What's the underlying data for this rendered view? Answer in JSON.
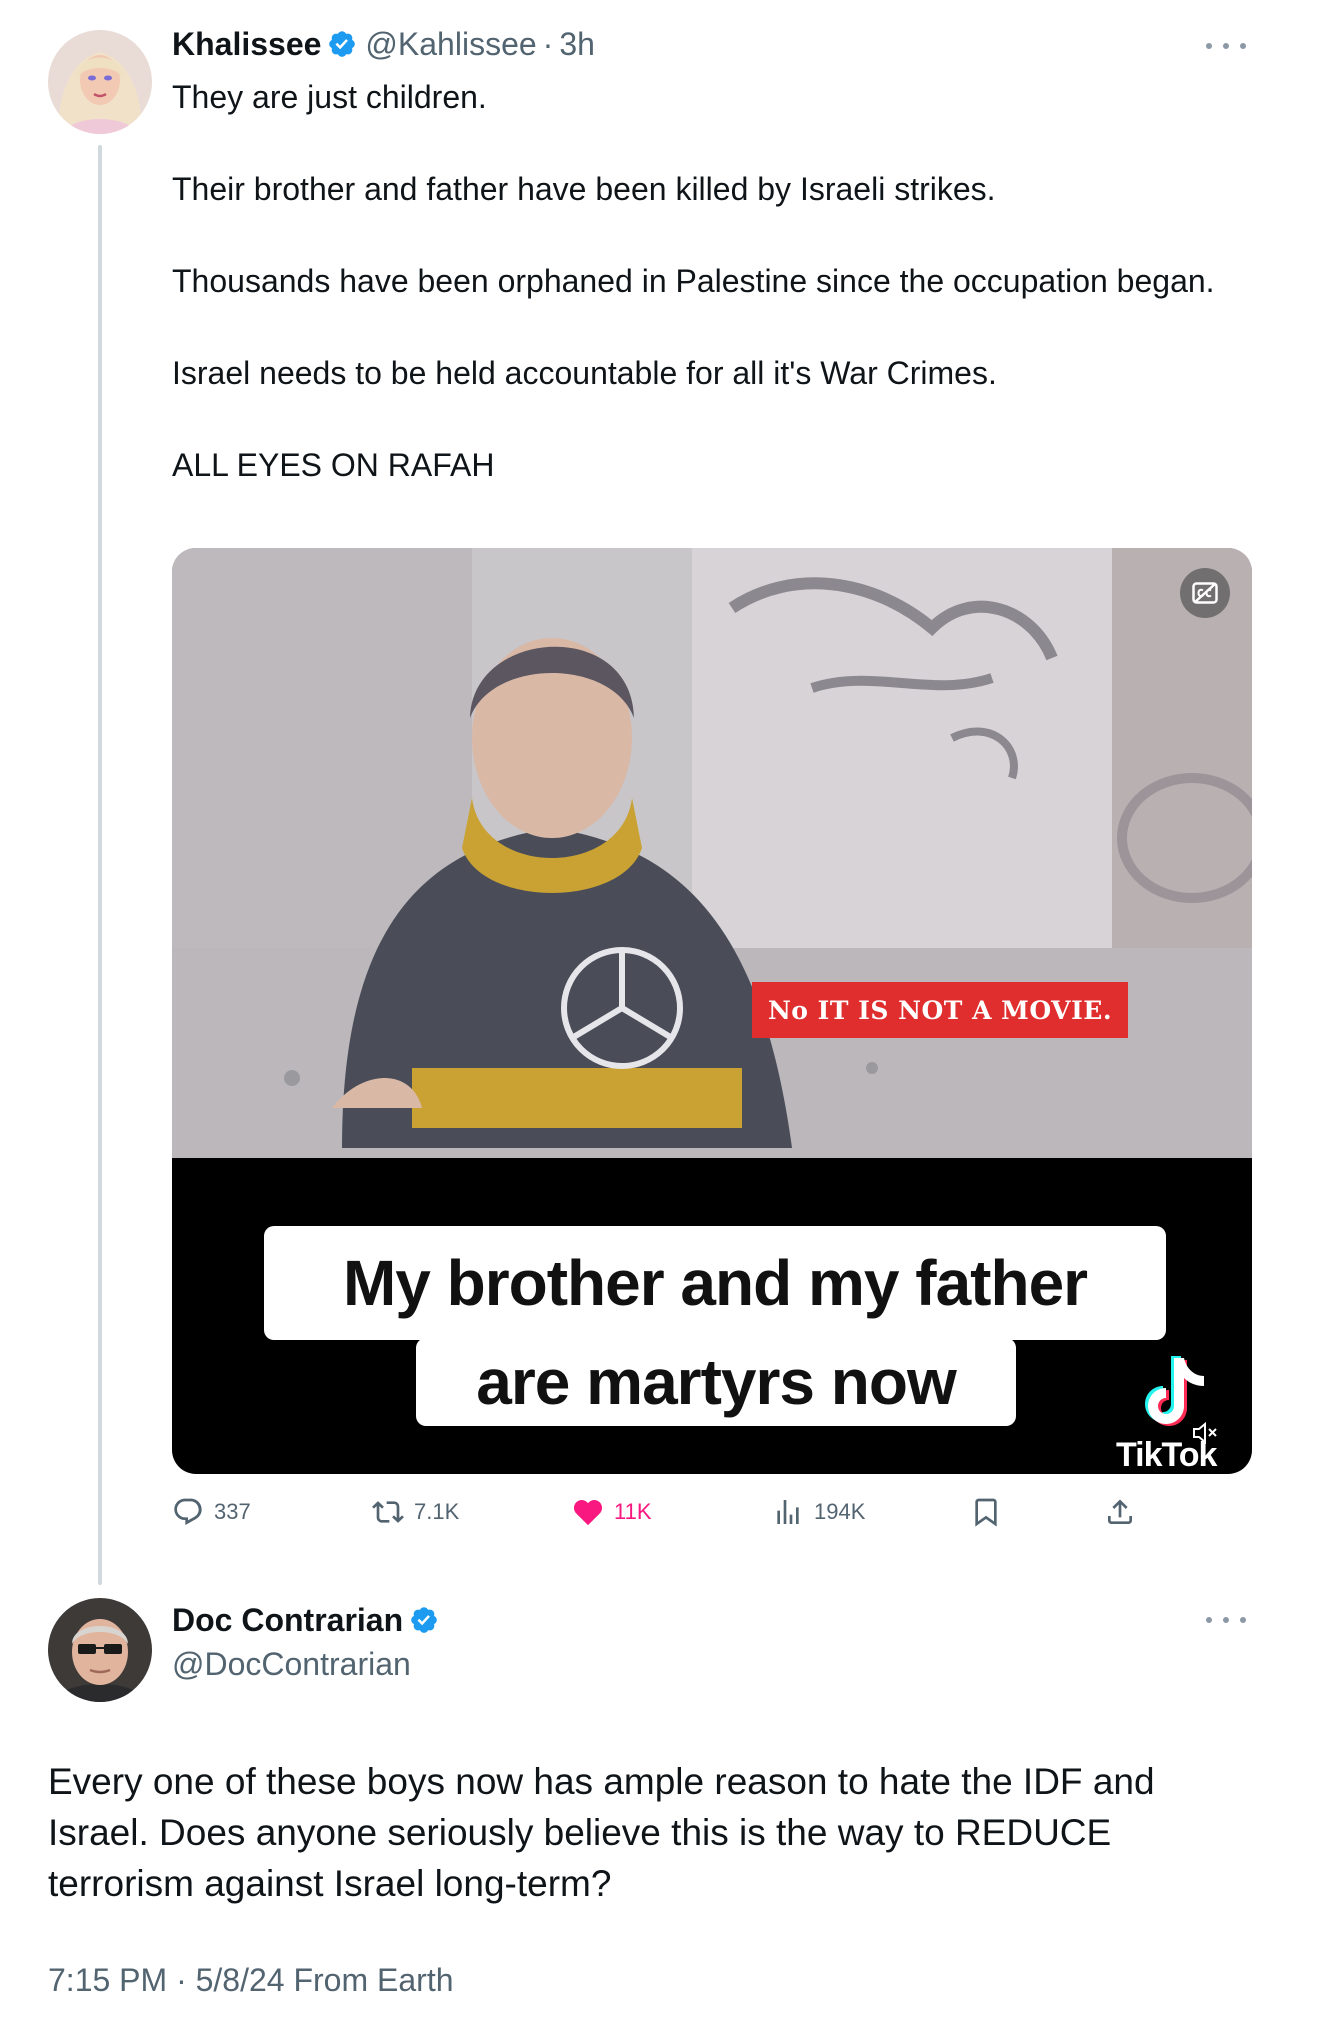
{
  "tweet1": {
    "author_name": "Khalissee",
    "handle": "@Kahlissee",
    "separator": "·",
    "time_ago": "3h",
    "paragraphs": [
      "They are just children.",
      "Their brother and father have been killed by Israeli strikes.",
      "Thousands have been orphaned in Palestine since the occupation began.",
      "Israel needs to be held accountable for all it's War Crimes.",
      "ALL EYES ON RAFAH"
    ],
    "media": {
      "banner_text": "No IT IS NOT A MOVIE.",
      "caption_line1": "My brother and my father",
      "caption_line2": "are martyrs now",
      "watermark": "TikTok"
    },
    "actions": {
      "replies": "337",
      "reposts": "7.1K",
      "likes": "11K",
      "views": "194K"
    }
  },
  "tweet2": {
    "author_name": "Doc Contrarian",
    "handle": "@DocContrarian",
    "text": "Every one of these boys now has ample reason to hate the IDF and Israel. Does anyone seriously believe this is the way to REDUCE terrorism against Israel long-term?",
    "timestamp": "7:15 PM · 5/8/24 From Earth"
  },
  "colors": {
    "verified": "#1d9bf0",
    "like": "#f91880",
    "secondary_text": "#536471",
    "banner": "#e02d2d"
  },
  "icons": [
    "verified-badge-icon",
    "more-icon",
    "reply-icon",
    "repost-icon",
    "heart-icon",
    "views-icon",
    "bookmark-icon",
    "share-icon",
    "captions-icon",
    "tiktok-logo-icon",
    "mute-icon"
  ]
}
